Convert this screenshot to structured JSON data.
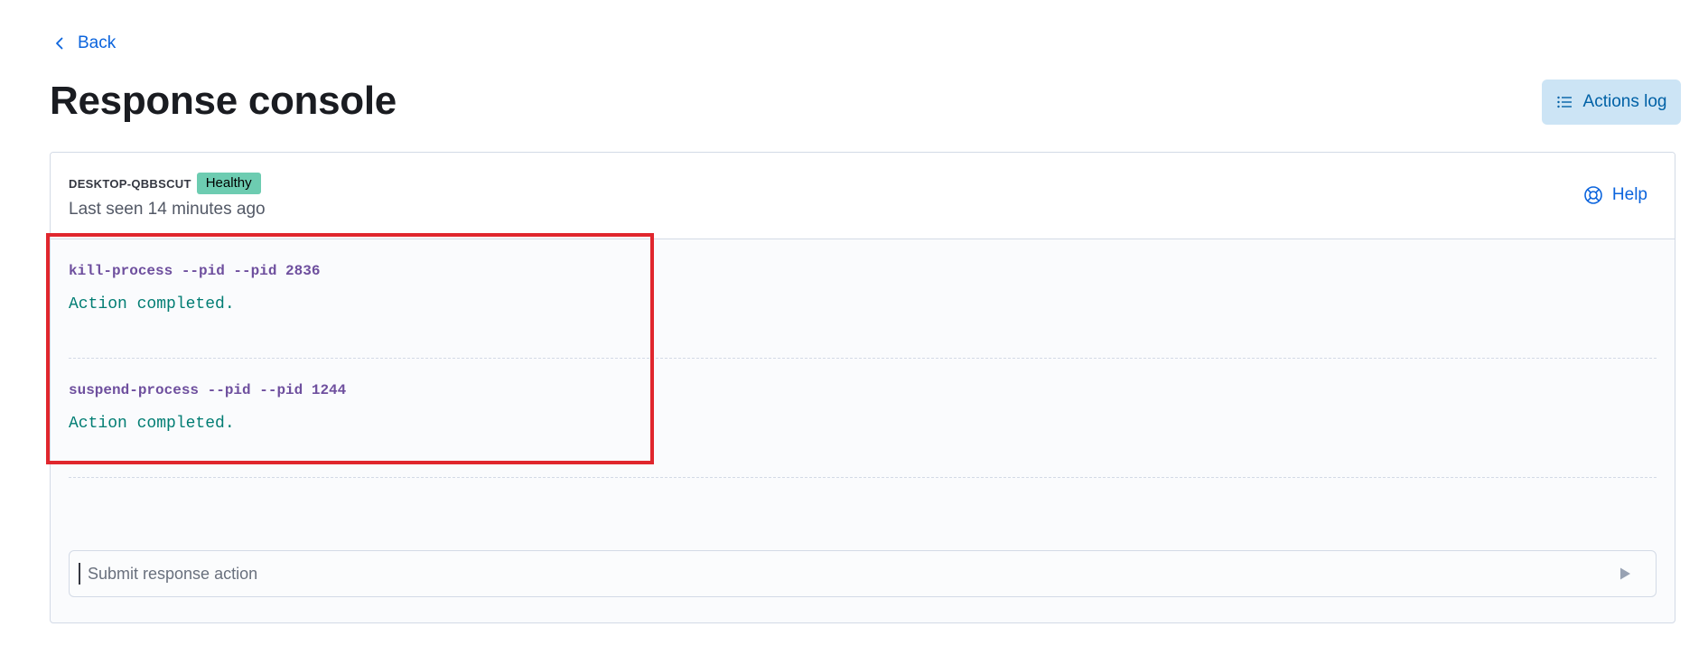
{
  "nav": {
    "back_label": "Back"
  },
  "header": {
    "title": "Response console",
    "actions_log_label": "Actions log"
  },
  "console": {
    "host": {
      "name": "DESKTOP-QBBSCUT",
      "status": "Healthy",
      "last_seen": "Last seen 14 minutes ago"
    },
    "help_label": "Help",
    "history": [
      {
        "command": "kill-process --pid --pid 2836",
        "result": "Action completed."
      },
      {
        "command": "suspend-process --pid --pid 1244",
        "result": "Action completed."
      }
    ],
    "input": {
      "placeholder": "Submit response action",
      "value": ""
    }
  },
  "colors": {
    "link": "#0b64dd",
    "badge_healthy": "#6dccb1",
    "command": "#6e4f9e",
    "result_success": "#017d73",
    "highlight": "#e0262d"
  },
  "icons": {
    "back": "chevron-left-icon",
    "actions_log": "list-icon",
    "help": "lifebuoy-icon",
    "submit": "play-icon"
  }
}
